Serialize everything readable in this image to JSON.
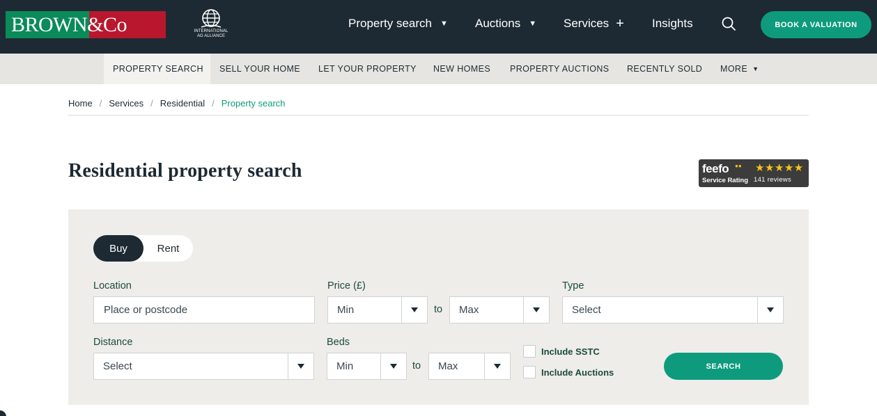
{
  "header": {
    "logo_text": "BROWN&Co",
    "alliance_text_1": "INTERNATIONAL",
    "alliance_text_2": "AG ALLIANCE",
    "nav": [
      {
        "label": "Property search"
      },
      {
        "label": "Auctions"
      },
      {
        "label": "Services"
      },
      {
        "label": "Insights"
      }
    ],
    "valuation_label": "BOOK A VALUATION"
  },
  "subnav": {
    "items": [
      {
        "label": "PROPERTY SEARCH"
      },
      {
        "label": "SELL YOUR HOME"
      },
      {
        "label": "LET YOUR PROPERTY"
      },
      {
        "label": "NEW HOMES"
      },
      {
        "label": "PROPERTY AUCTIONS"
      },
      {
        "label": "RECENTLY SOLD"
      },
      {
        "label": "MORE"
      }
    ]
  },
  "breadcrumb": {
    "items": [
      "Home",
      "Services",
      "Residential"
    ],
    "current": "Property search",
    "separator": "/"
  },
  "page": {
    "title": "Residential property search"
  },
  "feefo": {
    "logo": "feefo",
    "label": "Service Rating",
    "reviews": "141 reviews",
    "stars": "★★★★★"
  },
  "search": {
    "toggle": {
      "buy": "Buy",
      "rent": "Rent"
    },
    "location": {
      "label": "Location",
      "placeholder": "Place or postcode"
    },
    "price": {
      "label": "Price (£)",
      "min": "Min",
      "max": "Max",
      "to": "to"
    },
    "type": {
      "label": "Type",
      "value": "Select"
    },
    "distance": {
      "label": "Distance",
      "value": "Select"
    },
    "beds": {
      "label": "Beds",
      "min": "Min",
      "max": "Max",
      "to": "to"
    },
    "include_sstc": "Include SSTC",
    "include_auctions": "Include Auctions",
    "button": "SEARCH"
  },
  "colors": {
    "header_bg": "#1d2a33",
    "accent": "#0e9b7d",
    "subnav_bg": "#e6e5e1",
    "panel_bg": "#eeedea"
  }
}
